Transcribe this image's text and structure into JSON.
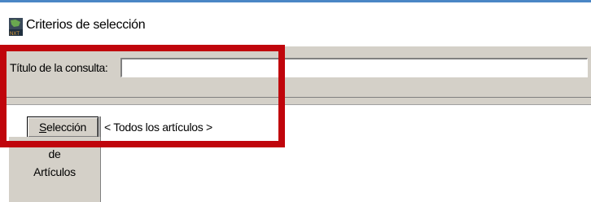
{
  "window": {
    "title": "Criterios de selección",
    "icon": "nxt-app-icon"
  },
  "form": {
    "title_label": "Título de la consulta:",
    "title_value": ""
  },
  "selection": {
    "button_label_prefix": "S",
    "button_label_rest": "elección",
    "value": "< Todos los artículos >"
  },
  "side_tab": {
    "line1": "de",
    "line2": "Artículos"
  },
  "colors": {
    "highlight_box": "#c0050c",
    "panel": "#d4d0c8",
    "accent_rule": "#4a86c5"
  }
}
